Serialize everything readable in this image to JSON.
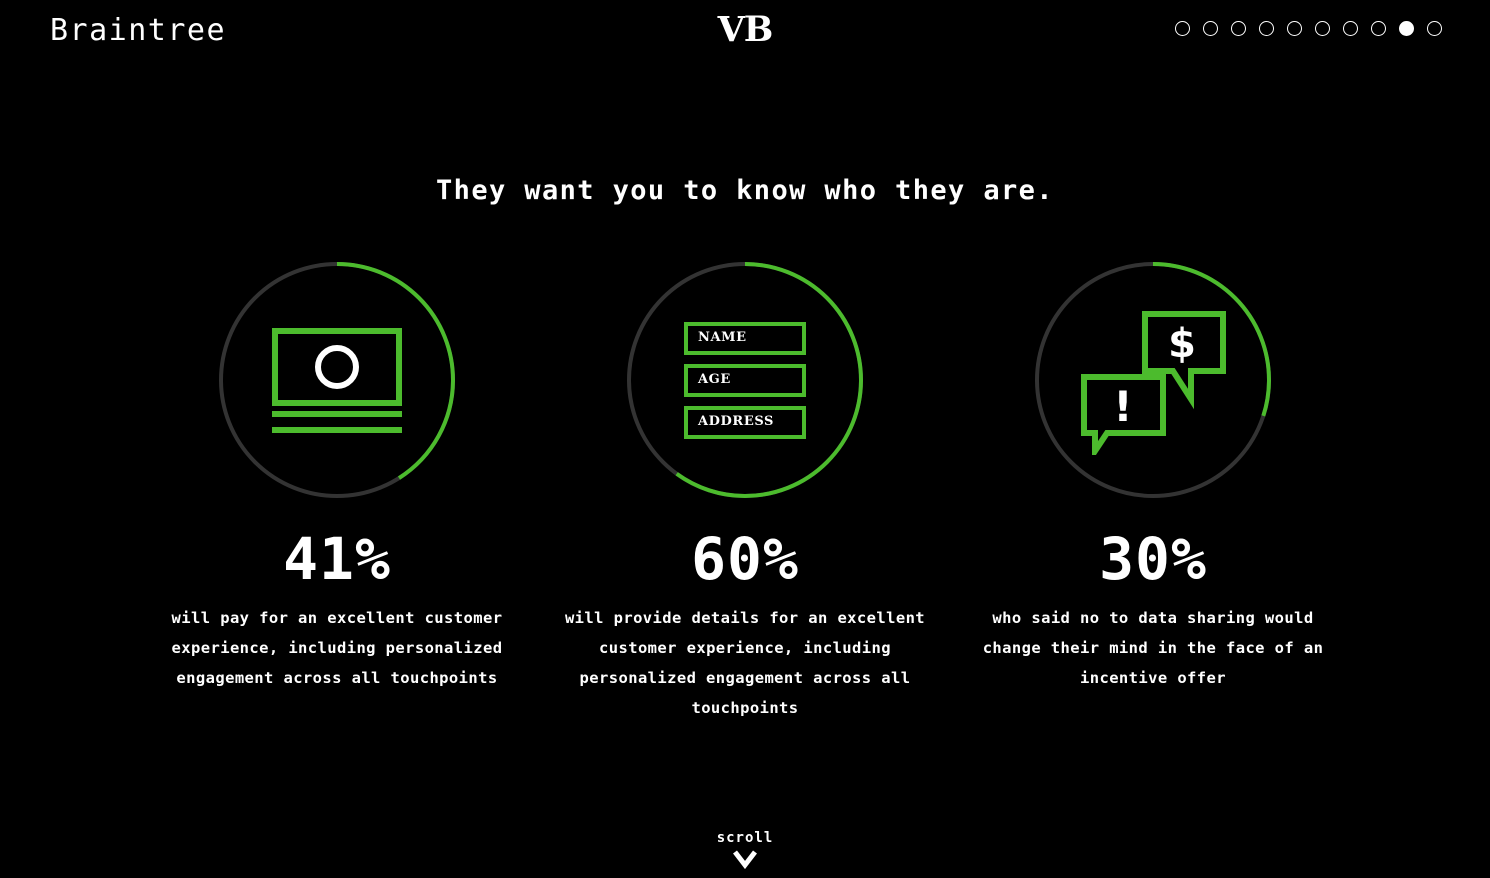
{
  "header": {
    "brand": "Braintree",
    "logo": "VB",
    "nav_dots": {
      "count": 10,
      "active_index": 8
    }
  },
  "headline": "They want you to know who they are.",
  "theme": {
    "background": "#000000",
    "accent_green": "#4CBB2D",
    "track_gray": "#333333",
    "text_white": "#ffffff"
  },
  "stats": [
    {
      "id": "stat-pay-for-experience",
      "percent_label": "41%",
      "percent_value": 41,
      "caption": "will pay for an excellent customer experience, including personalized engagement across all touchpoints",
      "icon": "banknote-icon"
    },
    {
      "id": "stat-provide-details",
      "percent_label": "60%",
      "percent_value": 60,
      "caption": "will provide details for an excellent customer experience, including personalized engagement across all touchpoints",
      "icon": "form-fields-icon",
      "fields": [
        "NAME",
        "AGE",
        "ADDRESS"
      ]
    },
    {
      "id": "stat-change-mind-incentive",
      "percent_label": "30%",
      "percent_value": 30,
      "caption": "who said no to data sharing would change their mind in the face of an incentive offer",
      "icon": "speech-bubbles-icon",
      "bubble_symbols": [
        "$",
        "!"
      ]
    }
  ],
  "scroll": {
    "label": "scroll",
    "chevron": "chevron-down-icon"
  }
}
